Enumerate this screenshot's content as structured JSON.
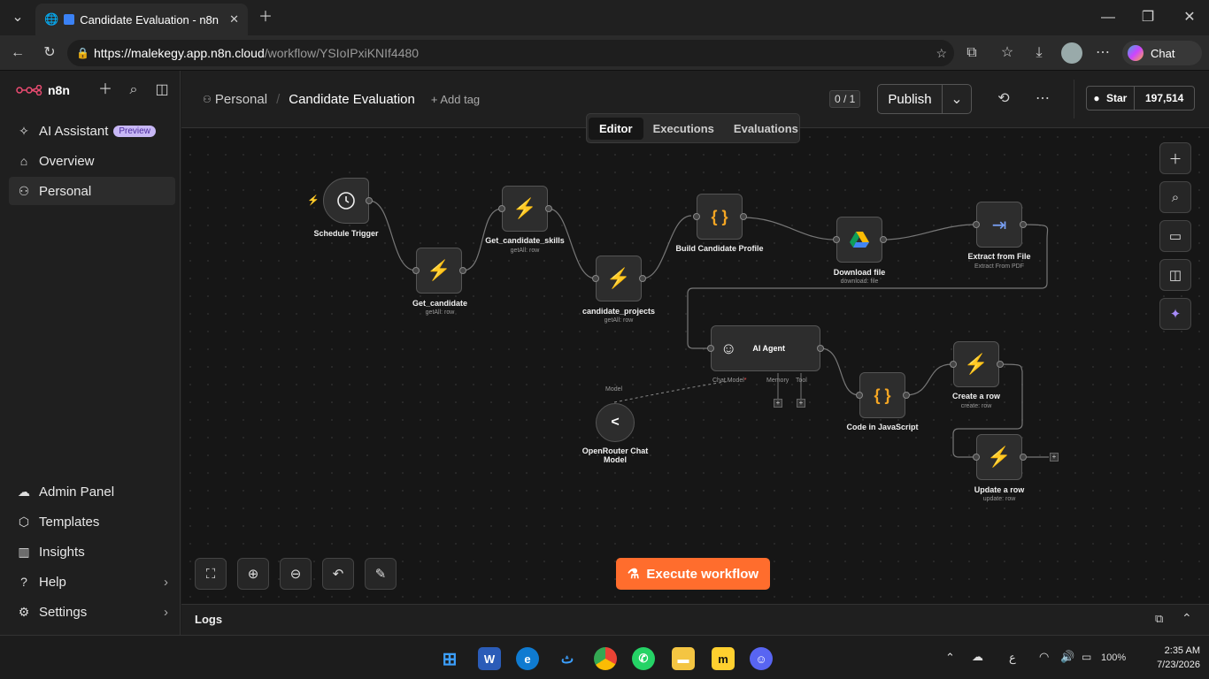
{
  "browser": {
    "tab_title": "Candidate Evaluation - n8n",
    "url_host": "https://malekegy.app.n8n.cloud",
    "url_path": "/workflow/YSIoIPxiKNIf4480",
    "chat_label": "Chat"
  },
  "sidebar": {
    "logo_text": "n8n",
    "top_items": [
      {
        "label": "AI Assistant",
        "badge": "Preview"
      },
      {
        "label": "Overview"
      },
      {
        "label": "Personal"
      }
    ],
    "bottom_items": [
      {
        "label": "Admin Panel"
      },
      {
        "label": "Templates"
      },
      {
        "label": "Insights"
      },
      {
        "label": "Help"
      },
      {
        "label": "Settings"
      }
    ]
  },
  "header": {
    "breadcrumb_project": "Personal",
    "workflow_name": "Candidate Evaluation",
    "add_tag": "+ Add tag",
    "counter": "0 / 1",
    "publish": "Publish",
    "star": "Star",
    "star_count": "197,514",
    "tabs": [
      "Editor",
      "Executions",
      "Evaluations"
    ],
    "active_tab": "Editor"
  },
  "nodes": [
    {
      "name": "Schedule Trigger",
      "sub": ""
    },
    {
      "name": "Get_candidate",
      "sub": "getAll: row"
    },
    {
      "name": "Get_candidate_skills",
      "sub": "getAll: row"
    },
    {
      "name": "candidate_projects",
      "sub": "getAll: row"
    },
    {
      "name": "Build Candidate Profile",
      "sub": ""
    },
    {
      "name": "Download file",
      "sub": "download: file"
    },
    {
      "name": "Extract from File",
      "sub": "Extract From PDF"
    },
    {
      "name": "AI Agent",
      "sub": ""
    },
    {
      "name": "OpenRouter Chat Model",
      "sub": ""
    },
    {
      "name": "Code in JavaScript",
      "sub": ""
    },
    {
      "name": "Create a row",
      "sub": "create: row"
    },
    {
      "name": "Update a row",
      "sub": "update: row"
    }
  ],
  "agent_ports": {
    "chat_model": "Chat Model",
    "memory": "Memory",
    "tool": "Tool",
    "model": "Model"
  },
  "canvas": {
    "execute_label": "Execute workflow"
  },
  "logs": {
    "label": "Logs"
  },
  "taskbar": {
    "time": "2:35 AM",
    "date": "7/23/2026",
    "battery": "100%",
    "lang": "ع"
  },
  "colors": {
    "accent_orange": "#ff6d2d",
    "node_green": "#3ecf8e",
    "code_orange": "#f5a623",
    "preview_badge": "#c7b7f5"
  }
}
